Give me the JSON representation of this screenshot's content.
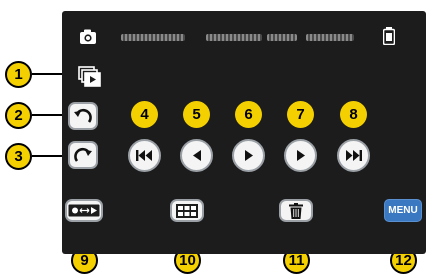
{
  "status": {
    "camera_icon": "camera-icon",
    "battery_icon": "battery-icon"
  },
  "controls": {
    "menu_label": "MENU"
  },
  "callouts": [
    "1",
    "2",
    "3",
    "4",
    "5",
    "6",
    "7",
    "8",
    "9",
    "10",
    "11",
    "12"
  ],
  "colors": {
    "screen": "#1c1c1c",
    "callout": "#f4d000",
    "menu": "#3a78c2"
  }
}
